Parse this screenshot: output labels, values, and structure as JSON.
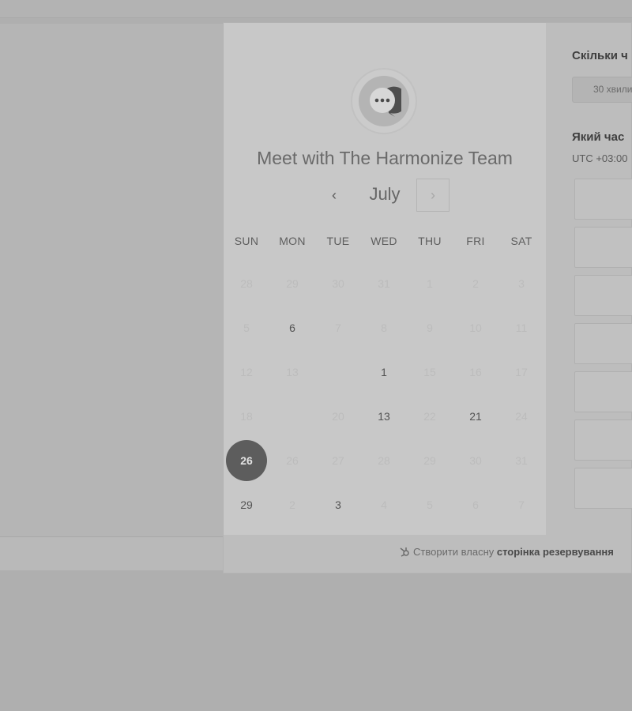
{
  "meeting": {
    "title": "Meet with The Harmonize Team"
  },
  "calendar": {
    "month": "July",
    "prev_label": "‹",
    "next_label": "›",
    "weekdays": [
      "SUN",
      "MON",
      "TUE",
      "WED",
      "THU",
      "FRI",
      "SAT"
    ],
    "weeks": [
      [
        {
          "d": "28",
          "a": false
        },
        {
          "d": "29",
          "a": false
        },
        {
          "d": "30",
          "a": false
        },
        {
          "d": "31",
          "a": false
        },
        {
          "d": "1",
          "a": false
        },
        {
          "d": "2",
          "a": false
        },
        {
          "d": "3",
          "a": false
        }
      ],
      [
        {
          "d": "5",
          "a": false
        },
        {
          "d": "6",
          "a": true
        },
        {
          "d": "7",
          "a": false
        },
        {
          "d": "8",
          "a": false
        },
        {
          "d": "9",
          "a": false
        },
        {
          "d": "10",
          "a": false
        },
        {
          "d": "11",
          "a": false
        }
      ],
      [
        {
          "d": "12",
          "a": false
        },
        {
          "d": "13",
          "a": false
        },
        {
          "d": "",
          "a": false
        },
        {
          "d": "1",
          "a": true
        },
        {
          "d": "15",
          "a": false
        },
        {
          "d": "16",
          "a": false
        },
        {
          "d": "17",
          "a": false
        }
      ],
      [
        {
          "d": "18",
          "a": false
        },
        {
          "d": "",
          "a": false
        },
        {
          "d": "20",
          "a": false
        },
        {
          "d": "13",
          "a": true
        },
        {
          "d": "22",
          "a": false
        },
        {
          "d": "21",
          "a": true
        },
        {
          "d": "24",
          "a": false
        }
      ],
      [
        {
          "d": "26",
          "a": true,
          "s": true
        },
        {
          "d": "26",
          "a": false
        },
        {
          "d": "27",
          "a": false
        },
        {
          "d": "28",
          "a": false
        },
        {
          "d": "29",
          "a": false
        },
        {
          "d": "30",
          "a": false
        },
        {
          "d": "31",
          "a": false
        }
      ],
      [
        {
          "d": "29",
          "a": true
        },
        {
          "d": "2",
          "a": false
        },
        {
          "d": "3",
          "a": true
        },
        {
          "d": "4",
          "a": false
        },
        {
          "d": "5",
          "a": false
        },
        {
          "d": "6",
          "a": false
        },
        {
          "d": "7",
          "a": false
        }
      ]
    ]
  },
  "booking": {
    "duration_heading": "Скільки ч",
    "duration_option": "30 хвили",
    "time_heading": "Який час",
    "timezone": "UTC +03:00",
    "slot_count": 7
  },
  "footer": {
    "link_prefix": "Створити власну ",
    "link_bold": "сторінка резервування"
  },
  "colors": {
    "selected_day": "#5d5d5d",
    "overlay_background": "#afafaf"
  }
}
